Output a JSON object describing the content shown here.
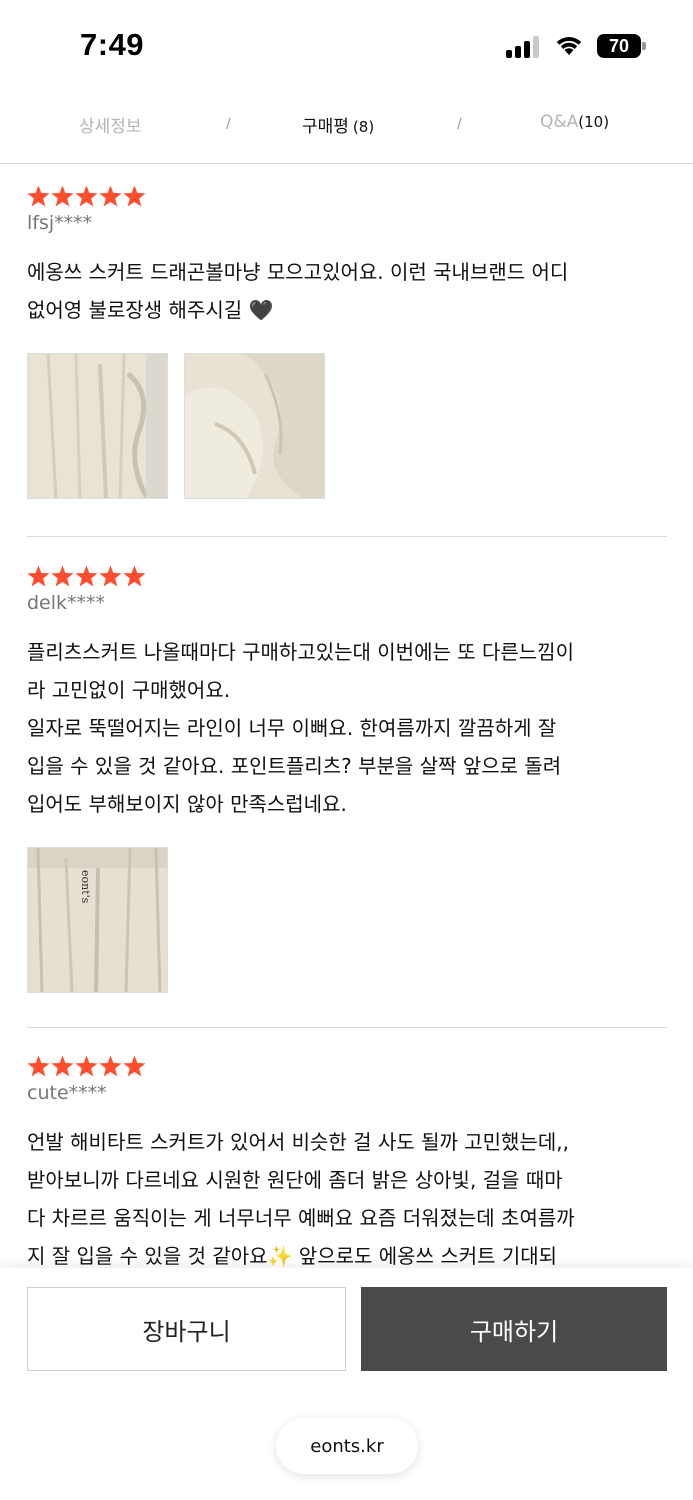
{
  "status_bar": {
    "time": "7:49",
    "battery": "70"
  },
  "tabs": [
    {
      "label": "상세정보",
      "count": ""
    },
    {
      "label": "구매평",
      "count": "(8)"
    },
    {
      "label": "Q&A",
      "count": "(10)"
    }
  ],
  "tab_separator": "/",
  "colors": {
    "star": "#ff4e2e",
    "buy_button": "#4a4a4a",
    "active_tab": "#111111",
    "inactive_tab": "#b5b5b5"
  },
  "reviews": [
    {
      "rating": 5,
      "user": "lfsj****",
      "text": "에옹쓰 스커트 드래곤볼마냥 모으고있어요. 이런 국내브랜드 어디\n없어영 불로장생 해주시길 🖤"
    },
    {
      "rating": 5,
      "user": "delk****",
      "text": "플리츠스커트 나올때마다 구매하고있는대 이번에는 또 다른느낌이\n라 고민없이 구매했어요.\n일자로 뚝떨어지는 라인이 너무 이뻐요. 한여름까지 깔끔하게 잘\n입을 수 있을 것 같아요. 포인트플리츠? 부분을 살짝 앞으로 돌려\n입어도 부해보이지 않아 만족스럽네요."
    },
    {
      "rating": 5,
      "user": "cute****",
      "text": "언발 해비타트 스커트가 있어서 비슷한 걸 사도 될까 고민했는데,,\n받아보니까 다르네요 시원한 원단에 좀더 밝은 상아빛, 걸을 때마\n다 차르르 움직이는 게 너무너무 예뻐요 요즘 더워졌는데 초여름까\n지 잘 입을 수 있을 것 같아요✨ 앞으로도 에옹쓰 스커트 기대되"
    }
  ],
  "photo_labels": {
    "tag_text": "eont's"
  },
  "bottom_bar": {
    "cart_label": "장바구니",
    "buy_label": "구매하기"
  },
  "url": "eonts.kr"
}
